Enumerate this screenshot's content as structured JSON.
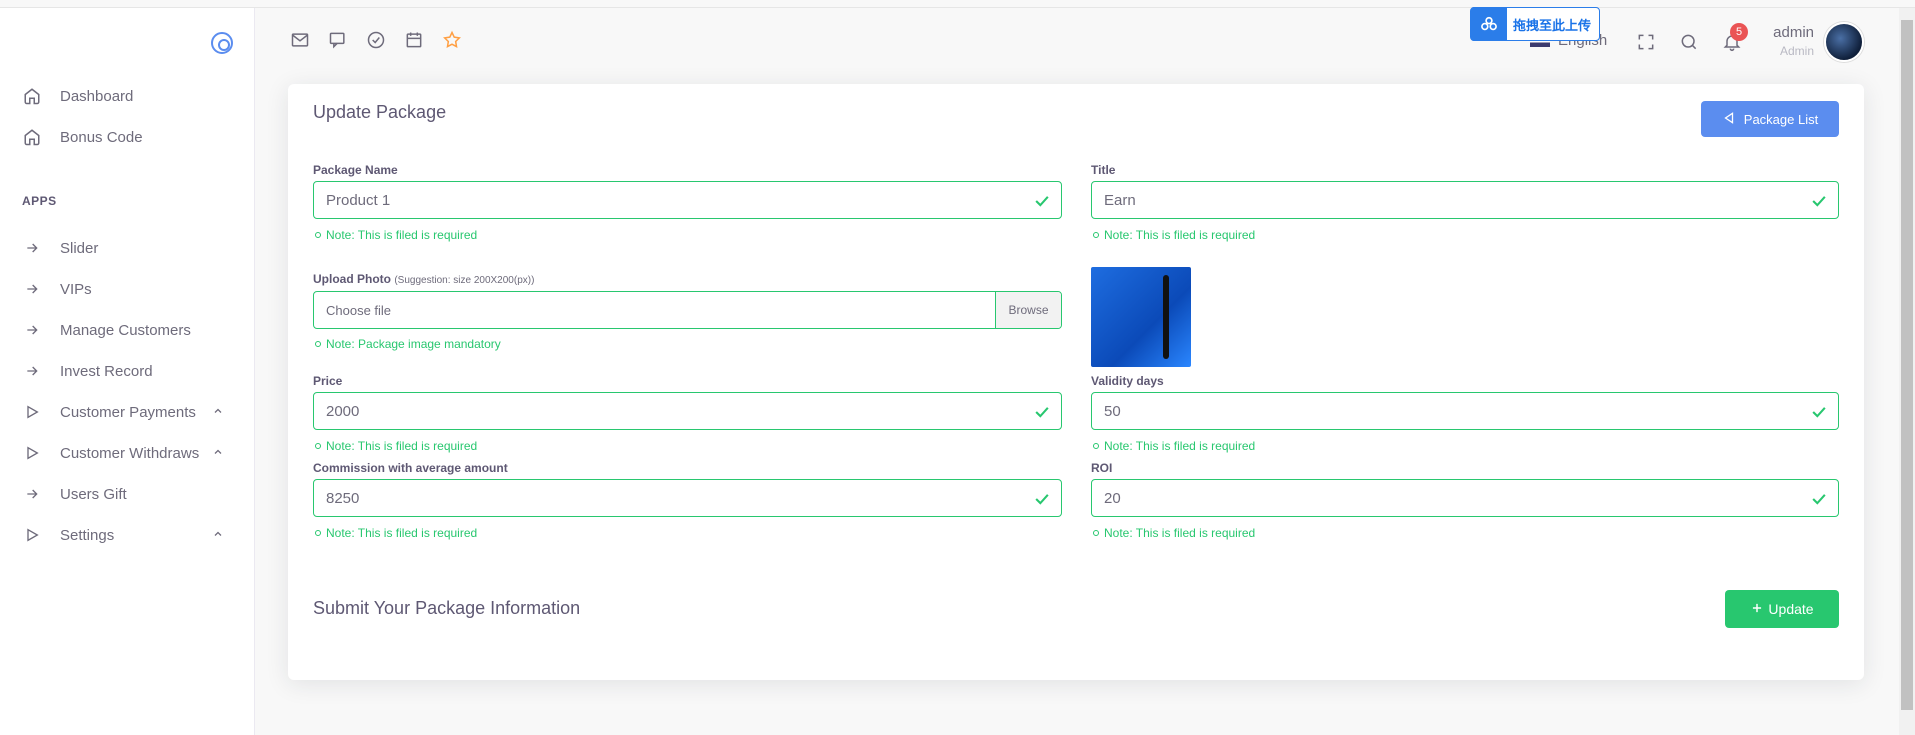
{
  "sidebar": {
    "items": [
      {
        "label": "Dashboard",
        "icon": "home-icon"
      },
      {
        "label": "Bonus Code",
        "icon": "home-icon"
      }
    ],
    "section": "APPS",
    "apps": [
      {
        "label": "Slider",
        "icon": "arrow-right-icon"
      },
      {
        "label": "VIPs",
        "icon": "arrow-right-icon"
      },
      {
        "label": "Manage Customers",
        "icon": "arrow-right-icon"
      },
      {
        "label": "Invest Record",
        "icon": "arrow-right-icon"
      },
      {
        "label": "Customer Payments",
        "icon": "play-icon",
        "expand": true
      },
      {
        "label": "Customer Withdraws",
        "icon": "play-icon",
        "expand": true
      },
      {
        "label": "Users Gift",
        "icon": "arrow-right-icon"
      },
      {
        "label": "Settings",
        "icon": "play-icon",
        "expand": true
      }
    ]
  },
  "navbar": {
    "upload_badge": "拖拽至此上传",
    "language": "English",
    "notification_count": "5",
    "user_name": "admin",
    "user_role": "Admin"
  },
  "form": {
    "title": "Update Package",
    "list_button": "Package List",
    "fields": {
      "package_name": {
        "label": "Package Name",
        "value": "Product 1",
        "note": "Note: This is filed is required"
      },
      "title": {
        "label": "Title",
        "value": "Earn",
        "note": "Note: This is filed is required"
      },
      "upload_photo": {
        "label": "Upload Photo",
        "hint": "(Suggestion: size 200X200(px))",
        "value": "Choose file",
        "browse": "Browse",
        "note": "Note: Package image mandatory"
      },
      "price": {
        "label": "Price",
        "value": "2000",
        "note": "Note: This is filed is required"
      },
      "validity_days": {
        "label": "Validity days",
        "value": "50",
        "note": "Note: This is filed is required"
      },
      "commission": {
        "label": "Commission with average amount",
        "value": "8250",
        "note": "Note: This is filed is required"
      },
      "roi": {
        "label": "ROI",
        "value": "20",
        "note": "Note: This is filed is required"
      }
    },
    "submit_title": "Submit Your Package Information",
    "update_button": "Update"
  },
  "colors": {
    "primary": "#5b8def",
    "success": "#28c76f",
    "danger": "#ea5455"
  }
}
